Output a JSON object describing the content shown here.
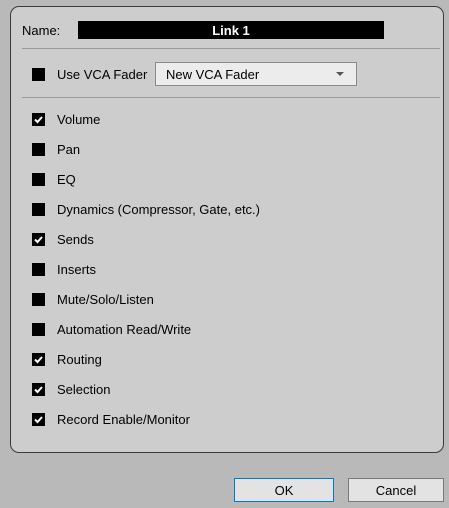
{
  "name": {
    "label": "Name:",
    "value": "Link 1"
  },
  "vca": {
    "label": "Use VCA Fader",
    "checked": false,
    "dropdown_value": "New VCA Fader"
  },
  "options": [
    {
      "label": "Volume",
      "checked": true
    },
    {
      "label": "Pan",
      "checked": false
    },
    {
      "label": "EQ",
      "checked": false
    },
    {
      "label": "Dynamics (Compressor, Gate, etc.)",
      "checked": false
    },
    {
      "label": "Sends",
      "checked": true
    },
    {
      "label": "Inserts",
      "checked": false
    },
    {
      "label": "Mute/Solo/Listen",
      "checked": false
    },
    {
      "label": "Automation Read/Write",
      "checked": false
    },
    {
      "label": "Routing",
      "checked": true
    },
    {
      "label": "Selection",
      "checked": true
    },
    {
      "label": "Record Enable/Monitor",
      "checked": true
    }
  ],
  "buttons": {
    "ok": "OK",
    "cancel": "Cancel"
  }
}
